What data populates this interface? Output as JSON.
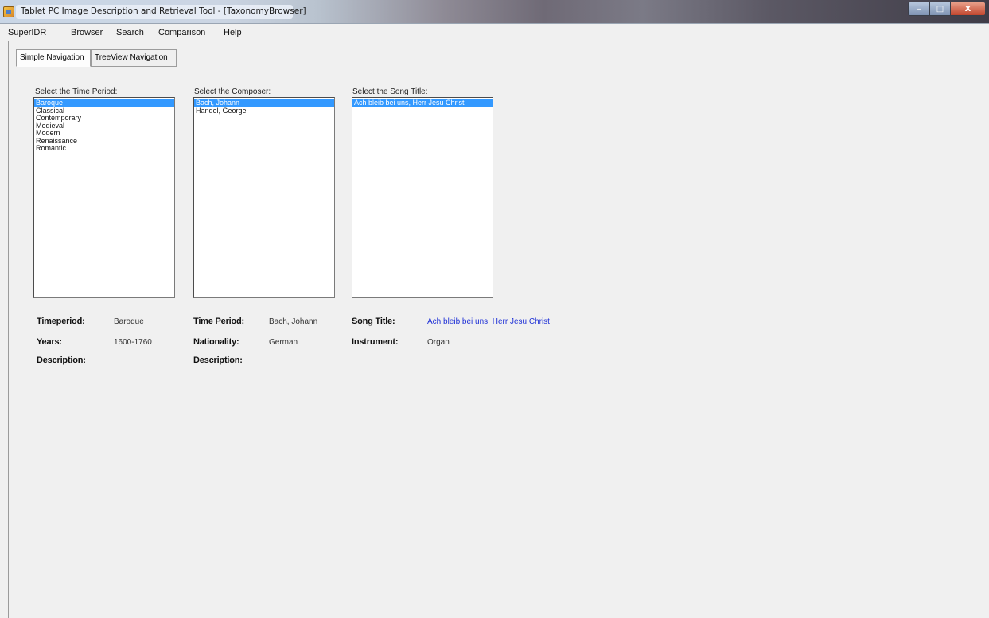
{
  "window": {
    "title": "Tablet PC Image Description and Retrieval Tool - [TaxonomyBrowser]",
    "controls": {
      "minimize": "–",
      "maximize": "□",
      "close": "X"
    }
  },
  "menu": {
    "items": [
      "SuperIDR",
      "Browser",
      "Search",
      "Comparison",
      "Help"
    ]
  },
  "tabs": [
    {
      "label": "Simple Navigation",
      "active": true
    },
    {
      "label": "TreeView Navigation",
      "active": false
    }
  ],
  "time_period": {
    "label": "Select the Time Period:",
    "options": [
      "Baroque",
      "Classical",
      "Contemporary",
      "Medieval",
      "Modern",
      "Renaissance",
      "Romantic"
    ],
    "selected": "Baroque"
  },
  "composer": {
    "label": "Select the Composer:",
    "options": [
      "Bach, Johann",
      "Handel, George"
    ],
    "selected": "Bach, Johann"
  },
  "song": {
    "label": "Select the Song Title:",
    "options": [
      "Ach bleib bei uns, Herr Jesu Christ"
    ],
    "selected": "Ach bleib bei uns, Herr Jesu Christ"
  },
  "info_period": {
    "timeperiod_label": "Timeperiod:",
    "timeperiod_value": "Baroque",
    "years_label": "Years:",
    "years_value": "1600-1760",
    "description_label": "Description:"
  },
  "info_composer": {
    "timeperiod_label": "Time Period:",
    "timeperiod_value": "Bach, Johann",
    "nationality_label": "Nationality:",
    "nationality_value": "German",
    "description_label": "Description:"
  },
  "info_song": {
    "title_label": "Song Title:",
    "title_value": "Ach bleib bei uns, Herr Jesu Christ",
    "instrument_label": "Instrument:",
    "instrument_value": "Organ"
  },
  "colors": {
    "selection": "#3399ff",
    "link": "#1d2fd6",
    "background": "#f0f0f0"
  }
}
